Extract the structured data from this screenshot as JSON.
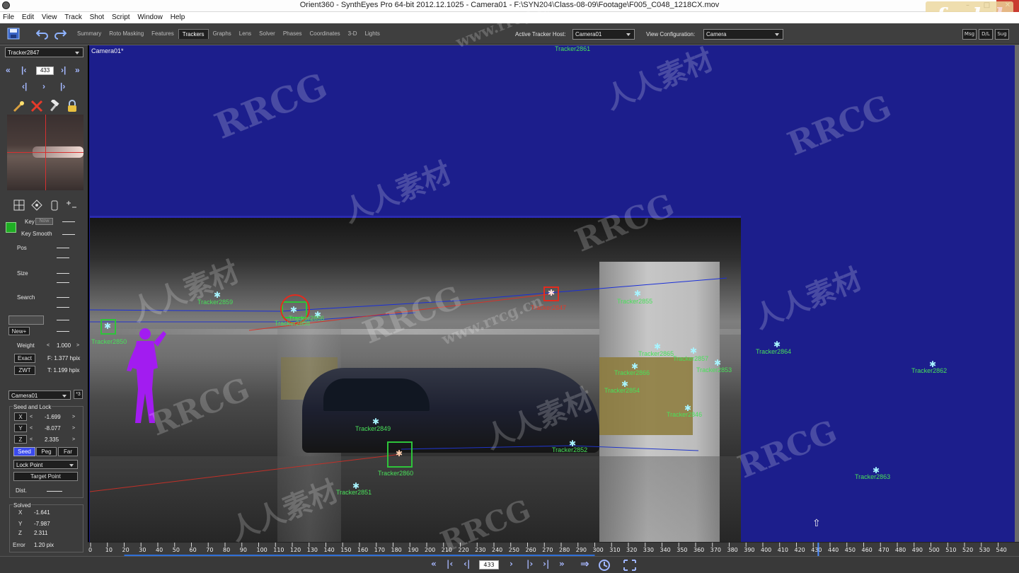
{
  "window": {
    "title": "Orient360 - SynthEyes Pro 64-bit 2012.12.1025 - Camera01 - F:\\SYN204\\Class-08-09\\Footage\\F005_C048_1218CX.mov",
    "logo_text": "fxphd"
  },
  "menu": [
    "File",
    "Edit",
    "View",
    "Track",
    "Shot",
    "Script",
    "Window",
    "Help"
  ],
  "tabs": [
    "Summary",
    "Roto Masking",
    "Features",
    "Trackers",
    "Graphs",
    "Lens",
    "Solver",
    "Phases",
    "Coordinates",
    "3-D",
    "Lights"
  ],
  "active_tab": "Trackers",
  "toolbar": {
    "active_tracker_host_label": "Active Tracker Host:",
    "active_tracker_host_value": "Camera01",
    "view_config_label": "View Configuration:",
    "view_config_value": "Camera",
    "msg_label": "Msg",
    "dl_label": "D/L",
    "sug_label": "Sug"
  },
  "left_panel": {
    "tracker_select": "Tracker2847",
    "frame": "433",
    "key_label": "Key",
    "key_placeholder": "Now",
    "key_smooth_label": "Key Smooth",
    "pos_label": "Pos",
    "size_label": "Size",
    "search_label": "Search",
    "new_label": "New+",
    "weight_label": "Weight",
    "weight_value": "1.000",
    "exact_label": "Exact",
    "exact_value": "F: 1.377 hpix",
    "zwt_label": "ZWT",
    "zwt_value": "T: 1.199 hpix",
    "camera_select": "Camera01",
    "seed_group_label": "Seed and Lock",
    "x_label": "X",
    "x_value": "-1.699",
    "y_label": "Y",
    "y_value": "-8.077",
    "z_label": "Z",
    "z_value": "2.335",
    "seed_label": "Seed",
    "peg_label": "Peg",
    "far_label": "Far",
    "lock_point_label": "Lock Point",
    "target_point_label": "Target Point",
    "dist_label": "Dist.",
    "solved_label": "Solved",
    "solved_x_label": "X",
    "solved_x": "-1.641",
    "solved_y_label": "Y",
    "solved_y": "-7.987",
    "solved_z_label": "Z",
    "solved_z": "2.311",
    "error_label": "Error",
    "error_value": "1.20 pix"
  },
  "viewport": {
    "camera_label": "Camera01*",
    "trackers": [
      {
        "name": "Tracker2861",
        "color": "green"
      },
      {
        "name": "Tracker2859",
        "color": "green"
      },
      {
        "name": "Tracker2858",
        "color": "green"
      },
      {
        "name": "Tracker2847",
        "color": "red"
      },
      {
        "name": "Tracker2850",
        "color": "green"
      },
      {
        "name": "Tracker2855",
        "color": "green"
      },
      {
        "name": "Tracker2864",
        "color": "green"
      },
      {
        "name": "Tracker2865",
        "color": "green"
      },
      {
        "name": "Tracker2857",
        "color": "green"
      },
      {
        "name": "Tracker2853",
        "color": "green"
      },
      {
        "name": "Tracker2866",
        "color": "green"
      },
      {
        "name": "Tracker2862",
        "color": "green"
      },
      {
        "name": "Tracker2854",
        "color": "green"
      },
      {
        "name": "Tracker2846",
        "color": "green"
      },
      {
        "name": "Tracker2849",
        "color": "green"
      },
      {
        "name": "Tracker2860",
        "color": "green"
      },
      {
        "name": "Tracker2852",
        "color": "green"
      },
      {
        "name": "Tracker2851",
        "color": "green"
      },
      {
        "name": "Tracker2863",
        "color": "green"
      },
      {
        "name": "Tracker2856",
        "color": "green"
      }
    ]
  },
  "timeline": {
    "ticks": [
      "0",
      "10",
      "20",
      "30",
      "40",
      "50",
      "60",
      "70",
      "80",
      "90",
      "100",
      "110",
      "120",
      "130",
      "140",
      "150",
      "160",
      "170",
      "180",
      "190",
      "200",
      "210",
      "220",
      "230",
      "240",
      "250",
      "260",
      "270",
      "280",
      "290",
      "300",
      "310",
      "320",
      "330",
      "340",
      "350",
      "360",
      "370",
      "380",
      "390",
      "400",
      "410",
      "420",
      "430",
      "440",
      "450",
      "460",
      "470",
      "480",
      "490",
      "500",
      "510",
      "520",
      "530",
      "540"
    ],
    "current_frame": 433
  },
  "transport": {
    "frame": "433"
  },
  "watermarks": [
    "RRCG",
    "人人素材",
    "www.rrcg.cn"
  ],
  "colors": {
    "viewport_bg": "#1c1e8c",
    "tracker_green": "#49e05a",
    "tracker_red": "#e03a2a",
    "active_tab_bg": "#202020",
    "seed_blue": "#3a4aee"
  }
}
